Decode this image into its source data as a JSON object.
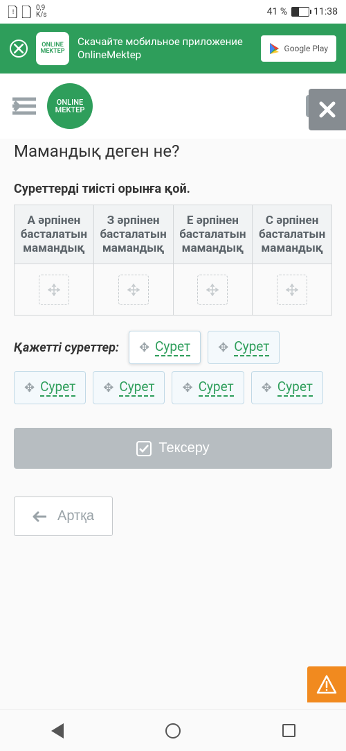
{
  "statusbar": {
    "speed_value": "0,9",
    "speed_unit": "K/s",
    "battery_pct": "41 %",
    "time": "11:38"
  },
  "banner": {
    "logo_text": "ONLINE\nMEKTEP",
    "text": "Скачайте мобильное приложение OnlineMektep",
    "store_label": "Google Play"
  },
  "header": {
    "logo_text": "ONLINE\nMEKTEP"
  },
  "question": {
    "title": "Мамандық деген не?",
    "instruction": "Суреттерді тиісті орынға қой."
  },
  "table": {
    "cols": [
      "А әрпінен басталатын мамандық",
      "З әрпінен басталатын мамандық",
      "Е әрпінен басталатын мамандық",
      "С әрпінен басталатын мамандық"
    ]
  },
  "needed": {
    "label": "Қажетті суреттер:",
    "chips": [
      "Сурет",
      "Сурет",
      "Сурет",
      "Сурет",
      "Сурет",
      "Сурет"
    ]
  },
  "buttons": {
    "check": "Тексеру",
    "back": "Артқа"
  }
}
